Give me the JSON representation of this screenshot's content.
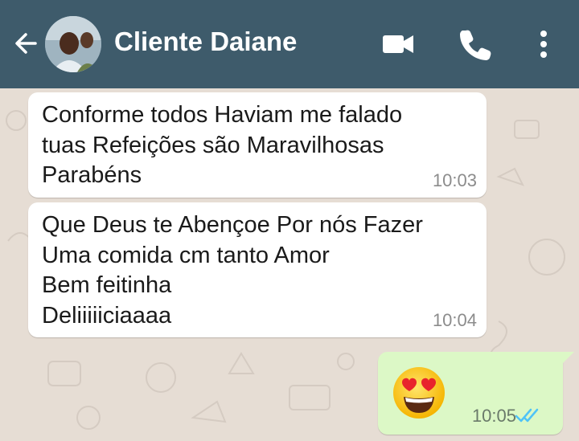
{
  "header": {
    "contact_name": "Cliente Daiane",
    "bar_color": "#3e5b6b",
    "icons": [
      "back-arrow-icon",
      "avatar",
      "video-camera-icon",
      "phone-icon",
      "more-vert-icon"
    ]
  },
  "messages": [
    {
      "direction": "incoming",
      "text": "Conforme todos Haviam me falado\ntuas Refeições são Maravilhosas\nParabéns",
      "time": "10:03"
    },
    {
      "direction": "incoming",
      "text": "Que Deus te Abençoe Por nós Fazer\nUma comida cm tanto Amor\nBem feitinha\nDeliiiiiciaaaa",
      "time": "10:04"
    },
    {
      "direction": "outgoing",
      "content": "heart-eyes-emoji",
      "time": "10:05",
      "status": "read"
    }
  ],
  "colors": {
    "incoming_bubble": "#ffffff",
    "outgoing_bubble": "#dcf8c6",
    "chat_background": "#e6ddd4",
    "read_ticks": "#4fc3f7"
  }
}
